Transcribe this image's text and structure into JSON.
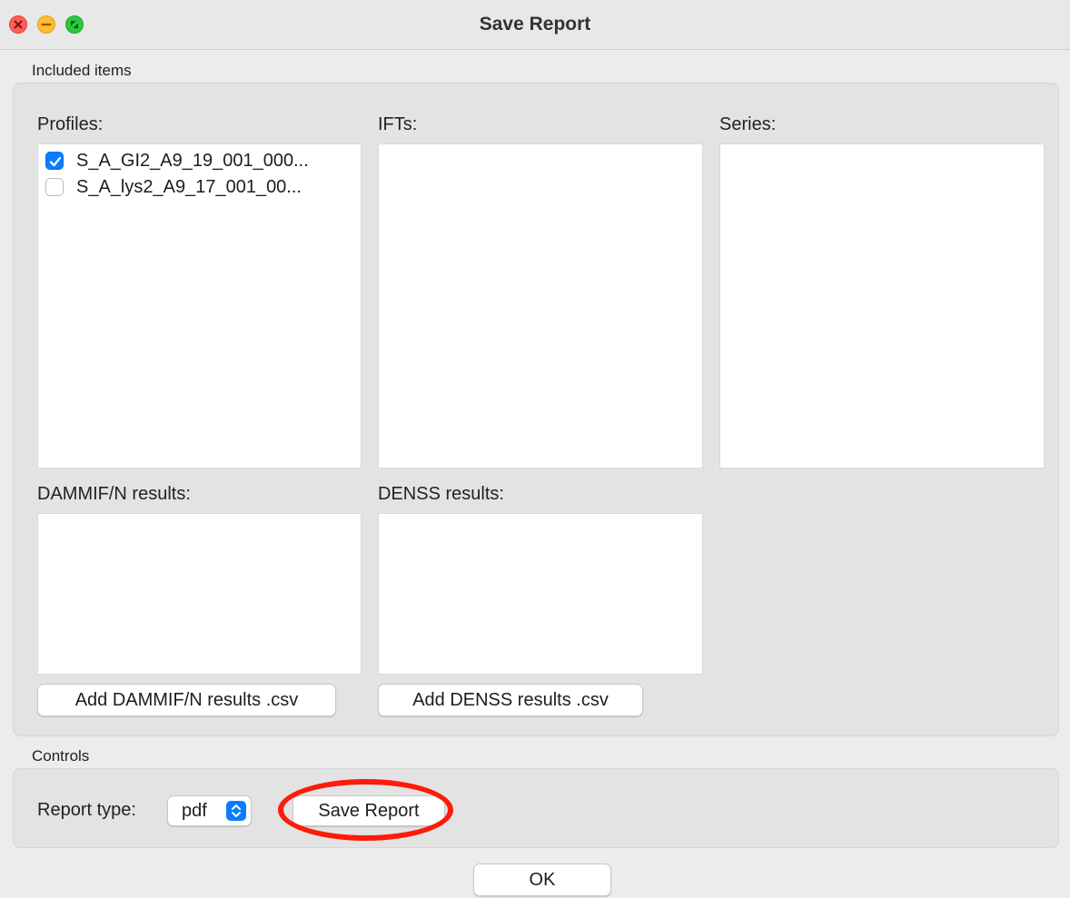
{
  "window": {
    "title": "Save Report"
  },
  "included": {
    "section_label": "Included items",
    "profiles": {
      "label": "Profiles:",
      "items": [
        {
          "name": "S_A_GI2_A9_19_001_000...",
          "checked": true
        },
        {
          "name": "S_A_lys2_A9_17_001_00...",
          "checked": false
        }
      ]
    },
    "ifts": {
      "label": "IFTs:"
    },
    "series": {
      "label": "Series:"
    },
    "dammif": {
      "label": "DAMMIF/N results:",
      "add_button": "Add DAMMIF/N results .csv"
    },
    "denss": {
      "label": "DENSS results:",
      "add_button": "Add DENSS results .csv"
    }
  },
  "controls": {
    "section_label": "Controls",
    "report_type_label": "Report type:",
    "report_type_value": "pdf",
    "save_button": "Save Report"
  },
  "footer": {
    "ok_button": "OK"
  },
  "colors": {
    "accent": "#0a7cff",
    "highlight_ring": "#ff1a0a"
  }
}
